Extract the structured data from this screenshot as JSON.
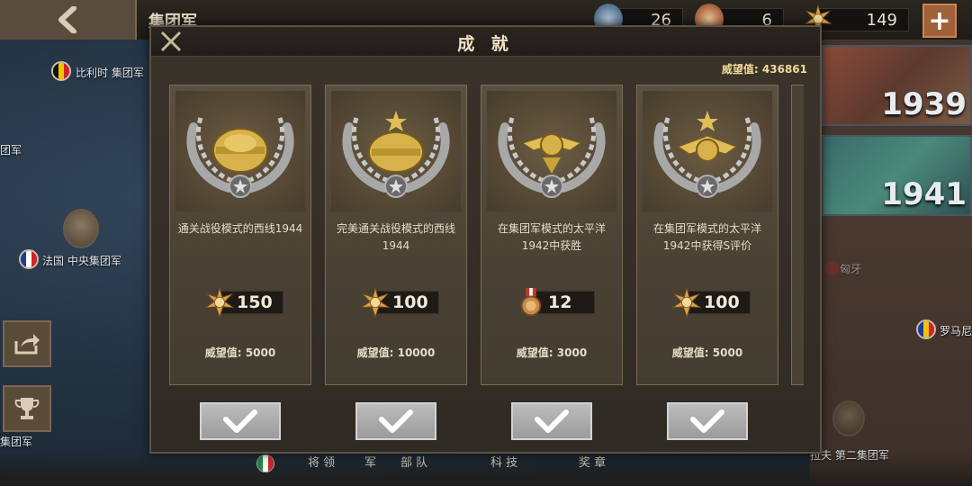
{
  "topbar": {
    "title": "集团军",
    "resources": [
      {
        "name": "medal-blue",
        "value": "26"
      },
      {
        "name": "medal-red",
        "value": "6"
      },
      {
        "name": "star-medal",
        "value": "149"
      }
    ]
  },
  "map": {
    "labels": {
      "belgium": "比利时 集团军",
      "left_group": "团军",
      "france": "法国 中央集团军",
      "left_bottom": "集团军",
      "romania": "罗马尼",
      "second_group": "拉夫 第二集团军",
      "hungary": "匈牙"
    },
    "years": [
      "1939",
      "1941"
    ],
    "bottom_tabs": [
      "将 领",
      "军",
      "部 队",
      "科 技",
      "奖 章"
    ]
  },
  "dialog": {
    "title": "成 就",
    "prestige_label": "威望值: 436861",
    "cards": [
      {
        "desc": "通关战役模式的西线1944",
        "reward_icon": "star-medal-icon",
        "reward": "150",
        "prestige": "威望值: 5000"
      },
      {
        "desc": "完美通关战役模式的西线1944",
        "reward_icon": "star-medal-icon",
        "reward": "100",
        "prestige": "威望值: 10000"
      },
      {
        "desc": "在集团军模式的太平洋1942中获胜",
        "reward_icon": "bronze-medal-icon",
        "reward": "12",
        "prestige": "威望值: 3000"
      },
      {
        "desc": "在集团军模式的太平洋1942中获得S评价",
        "reward_icon": "star-medal-icon",
        "reward": "100",
        "prestige": "威望值: 5000"
      }
    ]
  },
  "colors": {
    "gold": "#d7b24a",
    "panel": "#4a4234",
    "accent_title": "#f0e3c4"
  }
}
